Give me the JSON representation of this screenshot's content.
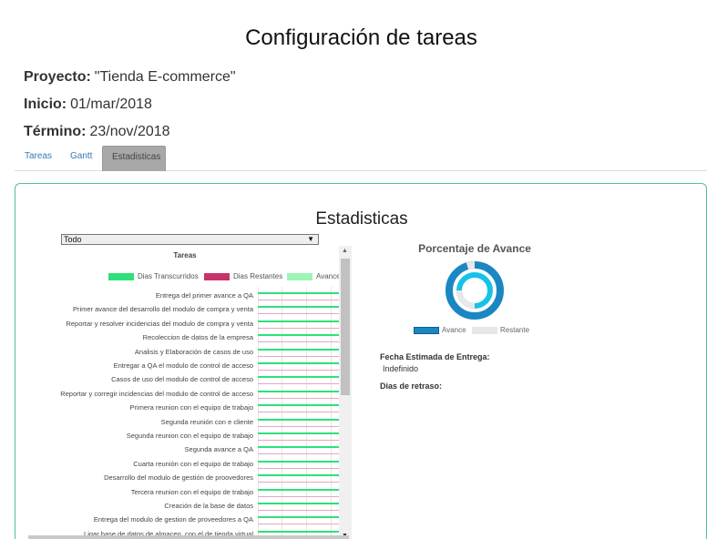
{
  "page": {
    "title": "Configuración de tareas",
    "project_label": "Proyecto:",
    "project_value": "\"Tienda E-commerce\"",
    "start_label": "Inicio:",
    "start_value": "01/mar/2018",
    "end_label": "Término:",
    "end_value": "23/nov/2018"
  },
  "tabs": [
    {
      "label": "Tareas",
      "active": false
    },
    {
      "label": "Gantt",
      "active": false
    },
    {
      "label": "Estadisticas",
      "active": true
    }
  ],
  "stats": {
    "title": "Estadisticas",
    "filter_value": "Todo",
    "chart_title": "Tareas",
    "legend": [
      {
        "label": "Dias Transcurridos",
        "color": "#2ee07a"
      },
      {
        "label": "Dias Restantes",
        "color": "#c8336a"
      },
      {
        "label": "Avance",
        "color": "#9df5b4"
      }
    ],
    "tasks": [
      "Entrega del primer avance a QA",
      "Primer avance del desarrollo del modulo de compra y venta",
      "Reportar y resolver incidencias del modulo de compra y venta",
      "Recoleccion de datos de la empresa",
      "Analisis y Elaboración de casos de uso",
      "Entregar a QA el modulo de control de acceso",
      "Casos de uso del modulo de control de acceso",
      "Reportar y corregir incidencias del modulo de control de acceso",
      "Primera reunion con el equipo de trabajo",
      "Segunda reunión con e cliente",
      "Segunda reunion con el equipo de trabajo",
      "Segunda avance a QA",
      "Cuarta reunión con el equipo de trabajo",
      "Desarrollo del modulo de gestión de proovedores",
      "Tercera reunion con el equipo de trabajo",
      "Creación de la base de datos",
      "Entrega del modulo de gestion de proveedores a QA",
      "Ligar base de datos de almacen. con el de tienda virtual"
    ],
    "donut_title": "Porcentaje de Avance",
    "donut_legend": [
      {
        "label": "Avance",
        "color": "#1a87c2"
      },
      {
        "label": "Restante",
        "color": "#e8e8e8"
      }
    ],
    "delivery_label": "Fecha Estimada de Entrega:",
    "delivery_value": "Indefinido",
    "delay_label": "Dias de retraso:"
  },
  "icons": {
    "dropdown": "triangle-down",
    "scroll_up": "triangle-up",
    "scroll_down": "triangle-down"
  }
}
